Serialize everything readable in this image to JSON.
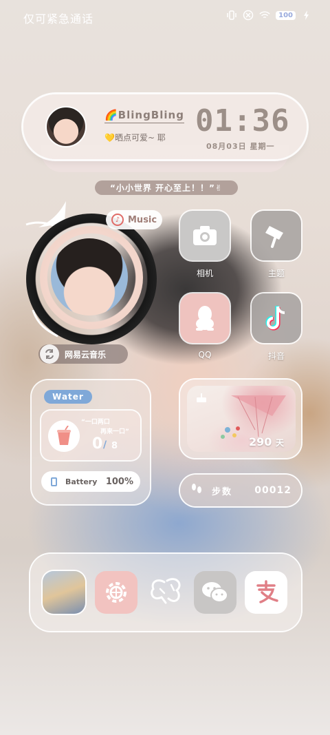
{
  "status_bar": {
    "left_text": "仅可紧急通话",
    "battery_level": "100",
    "icons": [
      "vibrate-icon",
      "no-sim-icon",
      "wifi-icon",
      "battery-icon",
      "charging-icon"
    ]
  },
  "profile_card": {
    "name": "🌈BlingBling",
    "bio": "💛晒点可爱~ 耶",
    "time": "01:36",
    "date": "08月03日  星期一"
  },
  "quote": "“小小世界 开心至上！！”✌",
  "music_widget": {
    "badge_label": "Music",
    "app_label": "网易云音乐"
  },
  "apps": {
    "camera": "相机",
    "theme": "主题",
    "qq": "QQ",
    "douyin": "抖音"
  },
  "water_widget": {
    "tag": "Water",
    "slogan_line1": "“一口两口",
    "slogan_line2": "再来一口”",
    "count": "0",
    "slash": "/",
    "total": "8",
    "battery_label": "Battery",
    "battery_value": "100%"
  },
  "day_widget": {
    "count": "290",
    "unit": "天"
  },
  "steps_widget": {
    "label": "步数",
    "value": "00012"
  },
  "dock": [
    "dock-photo",
    "settings",
    "butterfly",
    "wechat",
    "alipay"
  ],
  "colors": {
    "accent_blue": "#7fa8d8",
    "pink": "#efc3bf",
    "text_brown": "#9c8f88"
  }
}
